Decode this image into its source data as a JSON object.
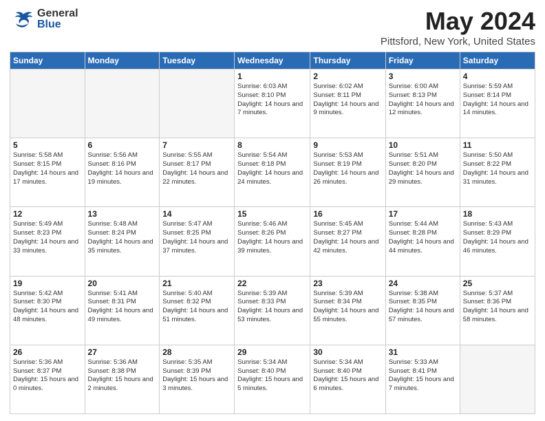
{
  "header": {
    "logo_general": "General",
    "logo_blue": "Blue",
    "month_title": "May 2024",
    "location": "Pittsford, New York, United States"
  },
  "weekdays": [
    "Sunday",
    "Monday",
    "Tuesday",
    "Wednesday",
    "Thursday",
    "Friday",
    "Saturday"
  ],
  "weeks": [
    [
      {
        "day": "",
        "info": ""
      },
      {
        "day": "",
        "info": ""
      },
      {
        "day": "",
        "info": ""
      },
      {
        "day": "1",
        "info": "Sunrise: 6:03 AM\nSunset: 8:10 PM\nDaylight: 14 hours\nand 7 minutes."
      },
      {
        "day": "2",
        "info": "Sunrise: 6:02 AM\nSunset: 8:11 PM\nDaylight: 14 hours\nand 9 minutes."
      },
      {
        "day": "3",
        "info": "Sunrise: 6:00 AM\nSunset: 8:13 PM\nDaylight: 14 hours\nand 12 minutes."
      },
      {
        "day": "4",
        "info": "Sunrise: 5:59 AM\nSunset: 8:14 PM\nDaylight: 14 hours\nand 14 minutes."
      }
    ],
    [
      {
        "day": "5",
        "info": "Sunrise: 5:58 AM\nSunset: 8:15 PM\nDaylight: 14 hours\nand 17 minutes."
      },
      {
        "day": "6",
        "info": "Sunrise: 5:56 AM\nSunset: 8:16 PM\nDaylight: 14 hours\nand 19 minutes."
      },
      {
        "day": "7",
        "info": "Sunrise: 5:55 AM\nSunset: 8:17 PM\nDaylight: 14 hours\nand 22 minutes."
      },
      {
        "day": "8",
        "info": "Sunrise: 5:54 AM\nSunset: 8:18 PM\nDaylight: 14 hours\nand 24 minutes."
      },
      {
        "day": "9",
        "info": "Sunrise: 5:53 AM\nSunset: 8:19 PM\nDaylight: 14 hours\nand 26 minutes."
      },
      {
        "day": "10",
        "info": "Sunrise: 5:51 AM\nSunset: 8:20 PM\nDaylight: 14 hours\nand 29 minutes."
      },
      {
        "day": "11",
        "info": "Sunrise: 5:50 AM\nSunset: 8:22 PM\nDaylight: 14 hours\nand 31 minutes."
      }
    ],
    [
      {
        "day": "12",
        "info": "Sunrise: 5:49 AM\nSunset: 8:23 PM\nDaylight: 14 hours\nand 33 minutes."
      },
      {
        "day": "13",
        "info": "Sunrise: 5:48 AM\nSunset: 8:24 PM\nDaylight: 14 hours\nand 35 minutes."
      },
      {
        "day": "14",
        "info": "Sunrise: 5:47 AM\nSunset: 8:25 PM\nDaylight: 14 hours\nand 37 minutes."
      },
      {
        "day": "15",
        "info": "Sunrise: 5:46 AM\nSunset: 8:26 PM\nDaylight: 14 hours\nand 39 minutes."
      },
      {
        "day": "16",
        "info": "Sunrise: 5:45 AM\nSunset: 8:27 PM\nDaylight: 14 hours\nand 42 minutes."
      },
      {
        "day": "17",
        "info": "Sunrise: 5:44 AM\nSunset: 8:28 PM\nDaylight: 14 hours\nand 44 minutes."
      },
      {
        "day": "18",
        "info": "Sunrise: 5:43 AM\nSunset: 8:29 PM\nDaylight: 14 hours\nand 46 minutes."
      }
    ],
    [
      {
        "day": "19",
        "info": "Sunrise: 5:42 AM\nSunset: 8:30 PM\nDaylight: 14 hours\nand 48 minutes."
      },
      {
        "day": "20",
        "info": "Sunrise: 5:41 AM\nSunset: 8:31 PM\nDaylight: 14 hours\nand 49 minutes."
      },
      {
        "day": "21",
        "info": "Sunrise: 5:40 AM\nSunset: 8:32 PM\nDaylight: 14 hours\nand 51 minutes."
      },
      {
        "day": "22",
        "info": "Sunrise: 5:39 AM\nSunset: 8:33 PM\nDaylight: 14 hours\nand 53 minutes."
      },
      {
        "day": "23",
        "info": "Sunrise: 5:39 AM\nSunset: 8:34 PM\nDaylight: 14 hours\nand 55 minutes."
      },
      {
        "day": "24",
        "info": "Sunrise: 5:38 AM\nSunset: 8:35 PM\nDaylight: 14 hours\nand 57 minutes."
      },
      {
        "day": "25",
        "info": "Sunrise: 5:37 AM\nSunset: 8:36 PM\nDaylight: 14 hours\nand 58 minutes."
      }
    ],
    [
      {
        "day": "26",
        "info": "Sunrise: 5:36 AM\nSunset: 8:37 PM\nDaylight: 15 hours\nand 0 minutes."
      },
      {
        "day": "27",
        "info": "Sunrise: 5:36 AM\nSunset: 8:38 PM\nDaylight: 15 hours\nand 2 minutes."
      },
      {
        "day": "28",
        "info": "Sunrise: 5:35 AM\nSunset: 8:39 PM\nDaylight: 15 hours\nand 3 minutes."
      },
      {
        "day": "29",
        "info": "Sunrise: 5:34 AM\nSunset: 8:40 PM\nDaylight: 15 hours\nand 5 minutes."
      },
      {
        "day": "30",
        "info": "Sunrise: 5:34 AM\nSunset: 8:40 PM\nDaylight: 15 hours\nand 6 minutes."
      },
      {
        "day": "31",
        "info": "Sunrise: 5:33 AM\nSunset: 8:41 PM\nDaylight: 15 hours\nand 7 minutes."
      },
      {
        "day": "",
        "info": ""
      }
    ]
  ]
}
